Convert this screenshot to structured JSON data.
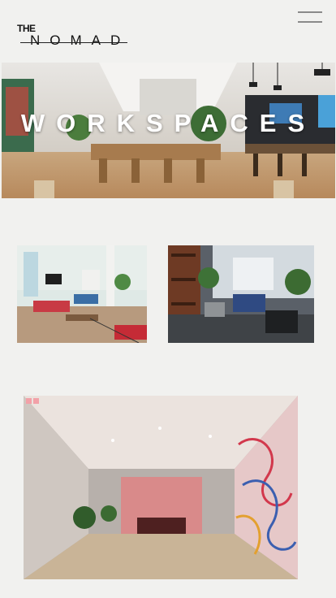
{
  "brand": {
    "prefix": "THE",
    "name": "NOMAD"
  },
  "hero": {
    "title": "WORKSPACES"
  },
  "icons": {
    "menu": "hamburger-menu-icon"
  }
}
